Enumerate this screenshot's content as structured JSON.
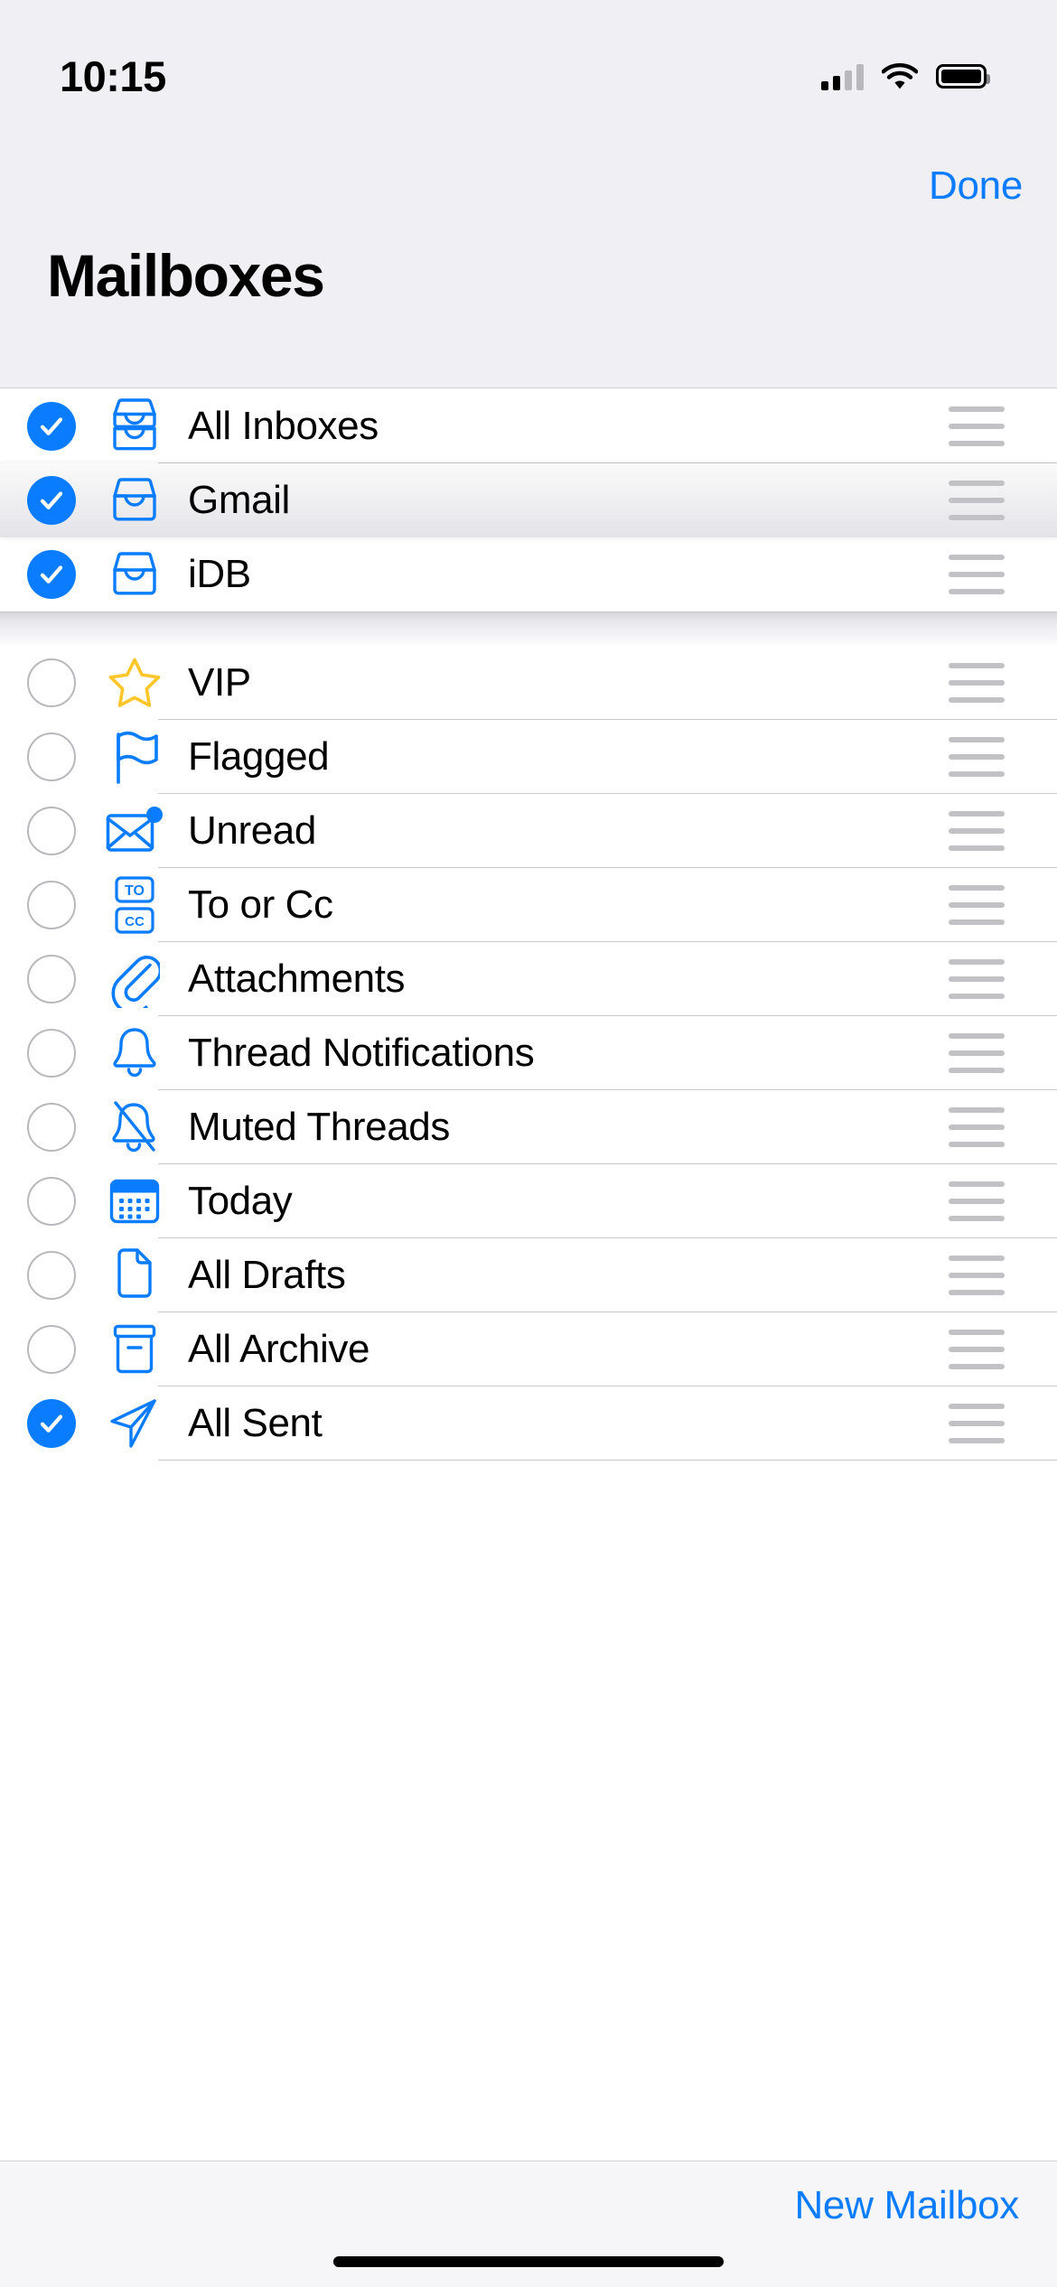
{
  "status_bar": {
    "time": "10:15",
    "cellular_icon": "cellular-bars-icon",
    "wifi_icon": "wifi-icon",
    "battery_icon": "battery-full-icon"
  },
  "nav_bar": {
    "done_label": "Done"
  },
  "header": {
    "title": "Mailboxes"
  },
  "colors": {
    "accent_blue": "#0a7cff",
    "star_yellow": "#ffc62b",
    "grip_gray": "#c2c1c6",
    "unchecked_gray": "#b9b8bd",
    "header_bg": "#f0eff4",
    "separator": "#c9c8cd"
  },
  "list": {
    "sections": [
      {
        "id": "inboxes",
        "rows": [
          {
            "label": "All Inboxes",
            "icon": "tray-stack-icon",
            "selected": true,
            "dragging": false,
            "reorder_handle": "reorder-grip-icon"
          },
          {
            "label": "Gmail",
            "icon": "tray-icon",
            "selected": true,
            "dragging": true,
            "reorder_handle": "reorder-grip-icon"
          },
          {
            "label": "iDB",
            "icon": "tray-icon",
            "selected": true,
            "dragging": false,
            "reorder_handle": "reorder-grip-icon"
          }
        ]
      },
      {
        "id": "smart-mailboxes",
        "rows": [
          {
            "label": "VIP",
            "icon": "star-icon",
            "selected": false,
            "dragging": false,
            "reorder_handle": "reorder-grip-icon"
          },
          {
            "label": "Flagged",
            "icon": "flag-icon",
            "selected": false,
            "dragging": false,
            "reorder_handle": "reorder-grip-icon"
          },
          {
            "label": "Unread",
            "icon": "envelope-badge-icon",
            "selected": false,
            "dragging": false,
            "reorder_handle": "reorder-grip-icon"
          },
          {
            "label": "To or Cc",
            "icon": "to-cc-icon",
            "selected": false,
            "dragging": false,
            "reorder_handle": "reorder-grip-icon"
          },
          {
            "label": "Attachments",
            "icon": "paperclip-icon",
            "selected": false,
            "dragging": false,
            "reorder_handle": "reorder-grip-icon"
          },
          {
            "label": "Thread Notifications",
            "icon": "bell-icon",
            "selected": false,
            "dragging": false,
            "reorder_handle": "reorder-grip-icon"
          },
          {
            "label": "Muted Threads",
            "icon": "bell-slash-icon",
            "selected": false,
            "dragging": false,
            "reorder_handle": "reorder-grip-icon"
          },
          {
            "label": "Today",
            "icon": "calendar-icon",
            "selected": false,
            "dragging": false,
            "reorder_handle": "reorder-grip-icon"
          },
          {
            "label": "All Drafts",
            "icon": "document-icon",
            "selected": false,
            "dragging": false,
            "reorder_handle": "reorder-grip-icon"
          },
          {
            "label": "All Archive",
            "icon": "archivebox-icon",
            "selected": false,
            "dragging": false,
            "reorder_handle": "reorder-grip-icon"
          },
          {
            "label": "All Sent",
            "icon": "paperplane-icon",
            "selected": true,
            "dragging": false,
            "reorder_handle": "reorder-grip-icon"
          }
        ]
      }
    ]
  },
  "toolbar": {
    "new_mailbox_label": "New Mailbox"
  }
}
